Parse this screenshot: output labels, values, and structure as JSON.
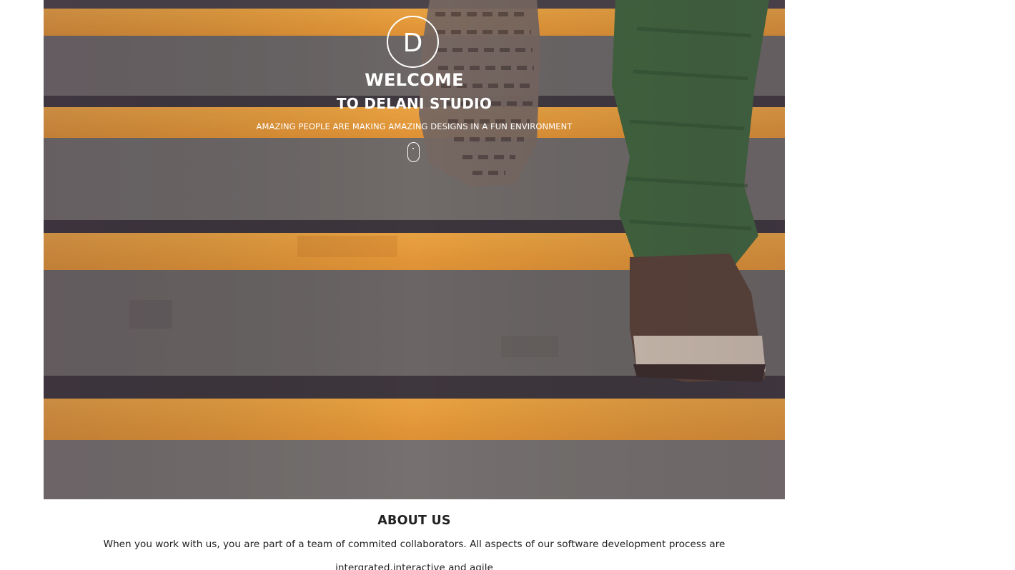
{
  "hero": {
    "logo_letter": "D",
    "welcome": "WELCOME",
    "studio": "TO DELANI STUDIO",
    "tagline": "AMAZING PEOPLE ARE MAKING AMAZING DESIGNS IN A FUN ENVIRONMENT",
    "scroll_icon": "mouse-scroll-icon",
    "background_image": "person-climbing-stairs-with-orange-edges"
  },
  "about": {
    "title": "ABOUT US",
    "text": "When you work with us, you are part of a team of commited collaborators. All aspects of our software development process are intergrated,interactive and agile"
  },
  "colors": {
    "stair_orange": "#f3a43a",
    "concrete_grey": "#6d6b66",
    "text_dark": "#222222",
    "overlay_white": "#ffffff"
  }
}
